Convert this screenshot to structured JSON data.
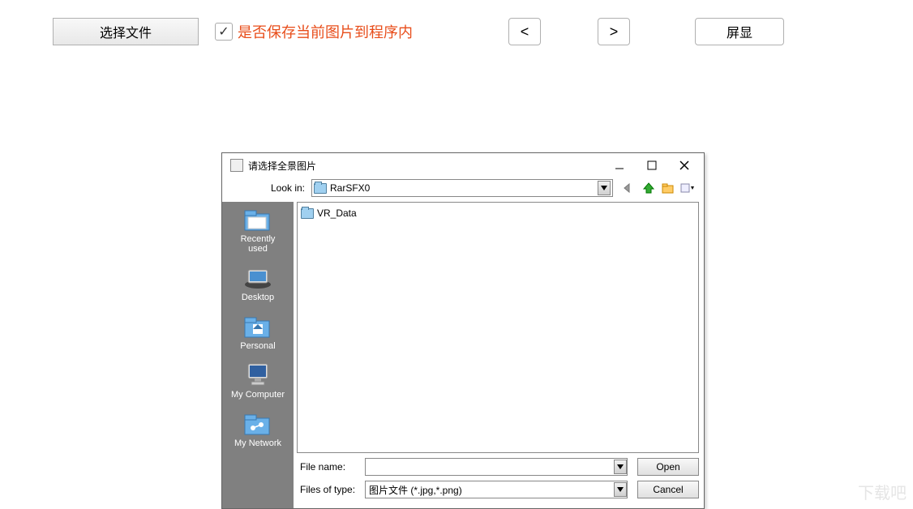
{
  "toolbar": {
    "select_file": "选择文件",
    "checkbox_checked": true,
    "checkbox_label": "是否保存当前图片到程序内",
    "prev": "<",
    "next": ">",
    "screen_display": "屏显"
  },
  "dialog": {
    "title": "请选择全景图片",
    "lookin_label": "Look in:",
    "lookin_value": "RarSFX0",
    "files": [
      {
        "name": "VR_Data",
        "type": "folder"
      }
    ],
    "filename_label": "File name:",
    "filename_value": "",
    "filetype_label": "Files of type:",
    "filetype_value": "图片文件 (*.jpg,*.png)",
    "open": "Open",
    "cancel": "Cancel",
    "sidebar": [
      {
        "label": "Recently\nused",
        "icon": "recent"
      },
      {
        "label": "Desktop",
        "icon": "desktop"
      },
      {
        "label": "Personal",
        "icon": "personal"
      },
      {
        "label": "My Computer",
        "icon": "computer"
      },
      {
        "label": "My Network",
        "icon": "network"
      }
    ]
  },
  "watermark": "下载吧"
}
